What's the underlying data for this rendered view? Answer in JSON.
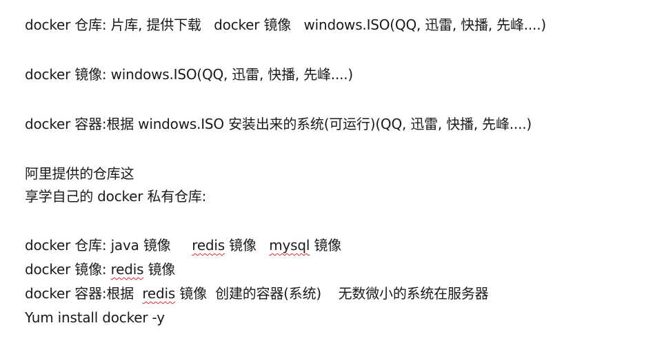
{
  "document": {
    "lines": [
      "docker 仓库: 片库, 提供下载   docker 镜像   windows.ISO(QQ, 迅雷, 快播, 先峰....)",
      "docker 镜像: windows.ISO(QQ, 迅雷, 快播, 先峰....)",
      "docker 容器:根据 windows.ISO 安装出来的系统(可运行)(QQ, 迅雷, 快播, 先峰....)",
      "阿里提供的仓库这",
      "享学自己的 docker 私有仓库:"
    ],
    "line6": {
      "prefix": "docker 仓库: java 镜像     ",
      "redis": "redis",
      "mid": " 镜像   ",
      "mysql": "mysql",
      "suffix": " 镜像"
    },
    "line7": {
      "prefix": "docker 镜像: ",
      "redis": "redis",
      "suffix": " 镜像"
    },
    "line8": {
      "prefix": "docker 容器:根据  ",
      "redis": "redis",
      "suffix": " 镜像  创建的容器(系统)    无数微小的系统在服务器"
    },
    "line9": "Yum install docker -y"
  }
}
